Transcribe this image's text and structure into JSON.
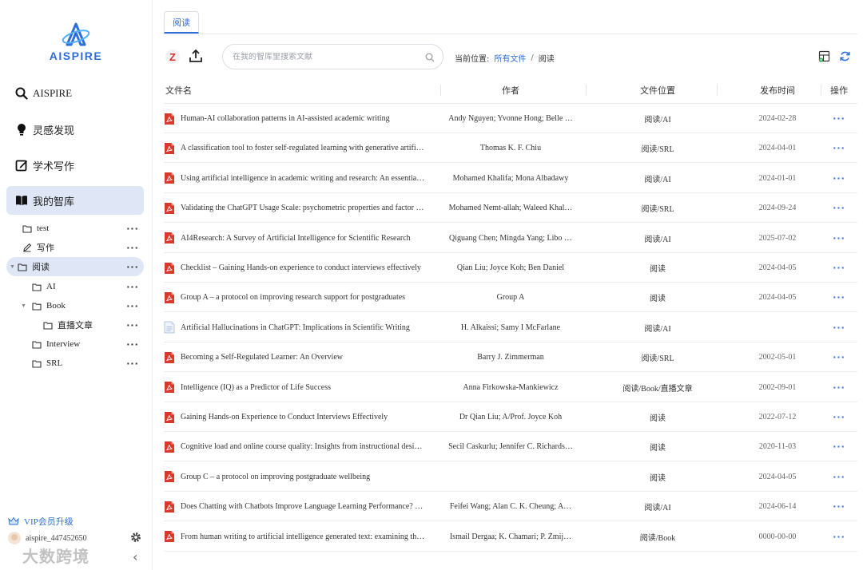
{
  "brand": {
    "name": "AISPIRE"
  },
  "sidebar": {
    "nav": [
      {
        "label": "AISPIRE",
        "icon": "search-icon"
      },
      {
        "label": "灵感发现",
        "icon": "bulb-icon"
      },
      {
        "label": "学术写作",
        "icon": "edit-icon"
      },
      {
        "label": "我的智库",
        "icon": "book-icon",
        "active": true
      }
    ],
    "tree": [
      {
        "label": "test",
        "icon": "folder-icon",
        "level": 0
      },
      {
        "label": "写作",
        "icon": "pencil-icon",
        "level": 0
      },
      {
        "label": "阅读",
        "icon": "folder-icon",
        "level": 0,
        "expanded": true,
        "selected": true
      },
      {
        "label": "AI",
        "icon": "folder-icon",
        "level": 1
      },
      {
        "label": "Book",
        "icon": "folder-icon",
        "level": 1,
        "expanded": true
      },
      {
        "label": "直播文章",
        "icon": "folder-icon",
        "level": 2
      },
      {
        "label": "Interview",
        "icon": "folder-icon",
        "level": 1
      },
      {
        "label": "SRL",
        "icon": "folder-icon",
        "level": 1
      }
    ],
    "vip_label": "VIP会员升级",
    "username": "aispire_447452650",
    "watermark": "大数跨境"
  },
  "main": {
    "tab_label": "阅读",
    "search_placeholder": "在我的智库里搜索文献",
    "breadcrumb": {
      "prefix": "当前位置:",
      "root": "所有文件",
      "separator": "/",
      "current": "阅读"
    },
    "columns": {
      "name": "文件名",
      "author": "作者",
      "location": "文件位置",
      "date": "发布时间",
      "action": "操作"
    },
    "rows": [
      {
        "type": "pdf",
        "name": "Human-AI collaboration patterns in AI-assisted academic writing",
        "author": "Andy Nguyen; Yvonne Hong; Belle …",
        "location": "阅读/AI",
        "date": "2024-02-28"
      },
      {
        "type": "pdf",
        "name": "A classification tool to foster self-regulated learning with generative artifi…",
        "author": "Thomas K. F. Chiu",
        "location": "阅读/SRL",
        "date": "2024-04-01"
      },
      {
        "type": "pdf",
        "name": "Using artificial intelligence in academic writing and research: An essentia…",
        "author": "Mohamed Khalifa; Mona Albadawy",
        "location": "阅读/AI",
        "date": "2024-01-01"
      },
      {
        "type": "pdf",
        "name": "Validating the ChatGPT Usage Scale: psychometric properties and factor …",
        "author": "Mohamed Nemt-allah; Waleed Khal…",
        "location": "阅读/SRL",
        "date": "2024-09-24"
      },
      {
        "type": "pdf",
        "name": "AI4Research: A Survey of Artificial Intelligence for Scientific Research",
        "author": "Qiguang Chen; Mingda Yang; Libo …",
        "location": "阅读/AI",
        "date": "2025-07-02"
      },
      {
        "type": "pdf",
        "name": "Checklist – Gaining Hands-on experience to conduct interviews effectively",
        "author": "Qian Liu; Joyce Koh; Ben Daniel",
        "location": "阅读",
        "date": "2024-04-05"
      },
      {
        "type": "pdf",
        "name": "Group A – a protocol on improving research support for postgraduates",
        "author": "Group A",
        "location": "阅读",
        "date": "2024-04-05"
      },
      {
        "type": "doc",
        "name": "Artificial Hallucinations in ChatGPT: Implications in Scientific Writing",
        "author": "H. Alkaissi; Samy I McFarlane",
        "location": "阅读/AI",
        "date": ""
      },
      {
        "type": "pdf",
        "name": "Becoming a Self-Regulated Learner: An Overview",
        "author": "Barry J. Zimmerman",
        "location": "阅读/SRL",
        "date": "2002-05-01"
      },
      {
        "type": "pdf",
        "name": "Intelligence (IQ) as a Predictor of Life Success",
        "author": "Anna Firkowska-Mankiewicz",
        "location": "阅读/Book/直播文章",
        "date": "2002-09-01"
      },
      {
        "type": "pdf",
        "name": "Gaining Hands-on Experience to Conduct Interviews Effectively",
        "author": "Dr Qian Liu; A/Prof. Joyce Koh",
        "location": "阅读",
        "date": "2022-07-12"
      },
      {
        "type": "pdf",
        "name": "Cognitive load and online course quality: Insights from instructional desi…",
        "author": "Secil Caskurlu; Jennifer C. Richards…",
        "location": "阅读",
        "date": "2020-11-03"
      },
      {
        "type": "pdf",
        "name": "Group C – a protocol on improving postgraduate wellbeing",
        "author": "",
        "location": "阅读",
        "date": "2024-04-05"
      },
      {
        "type": "pdf",
        "name": "Does Chatting with Chatbots Improve Language Learning Performance? …",
        "author": "Feifei Wang; Alan C. K. Cheung; A…",
        "location": "阅读/AI",
        "date": "2024-06-14"
      },
      {
        "type": "pdf",
        "name": "From human writing to artificial intelligence generated text: examining th…",
        "author": "Ismail Dergaa; K. Chamari; P. Żmij…",
        "location": "阅读/Book",
        "date": "0000-00-00"
      }
    ],
    "row_action_label": "···"
  },
  "colors": {
    "accent": "#2f6ed8",
    "pdf": "#d9392b",
    "active_bg": "#dfe6f6"
  }
}
